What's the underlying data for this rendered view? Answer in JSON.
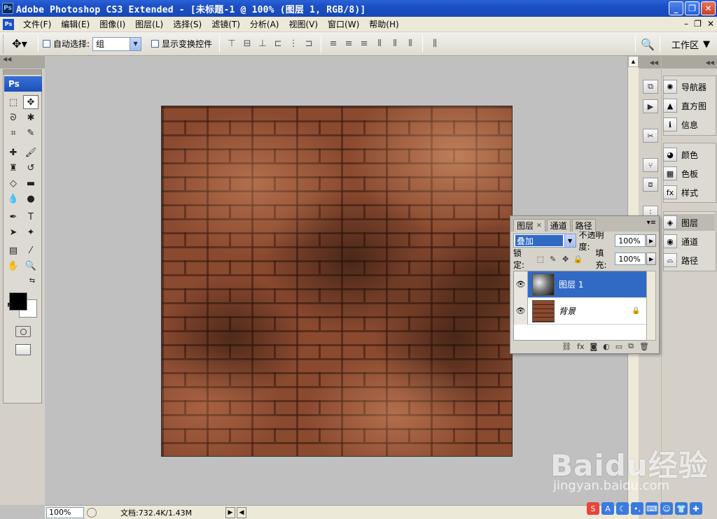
{
  "titlebar": {
    "icon": "Ps",
    "title": "Adobe Photoshop CS3 Extended - [未标题-1 @ 100% (图层 1, RGB/8)]",
    "buttons": [
      "minimize-icon",
      "restore-icon",
      "close-icon"
    ]
  },
  "menubar": {
    "icon": "Ps",
    "items": [
      "文件(F)",
      "编辑(E)",
      "图像(I)",
      "图层(L)",
      "选择(S)",
      "滤镜(T)",
      "分析(A)",
      "视图(V)",
      "窗口(W)",
      "帮助(H)"
    ]
  },
  "options": {
    "auto_select_label": "自动选择:",
    "auto_select_value": "组",
    "show_transform_label": "显示变换控件",
    "workspace_label": "工作区"
  },
  "toolbox": {
    "badge": "Ps"
  },
  "statusbar": {
    "zoom": "100%",
    "doc_info": "文档:732.4K/1.43M"
  },
  "right_panels": {
    "group1": [
      "导航器",
      "直方图",
      "信息"
    ],
    "group2": [
      "颜色",
      "色板",
      "样式"
    ],
    "group3": [
      "图层",
      "通道",
      "路径"
    ]
  },
  "layers_panel": {
    "tabs": [
      "图层",
      "通道",
      "路径"
    ],
    "blend_mode": "叠加",
    "opacity_label": "不透明度:",
    "opacity_value": "100%",
    "lock_label": "锁定:",
    "fill_label": "填充:",
    "fill_value": "100%",
    "layers": [
      {
        "name": "图层 1",
        "selected": true
      },
      {
        "name": "背景",
        "selected": false,
        "locked": true
      }
    ]
  },
  "watermark": {
    "main": "Baidu经验",
    "sub": "jingyan.baidu.com"
  }
}
